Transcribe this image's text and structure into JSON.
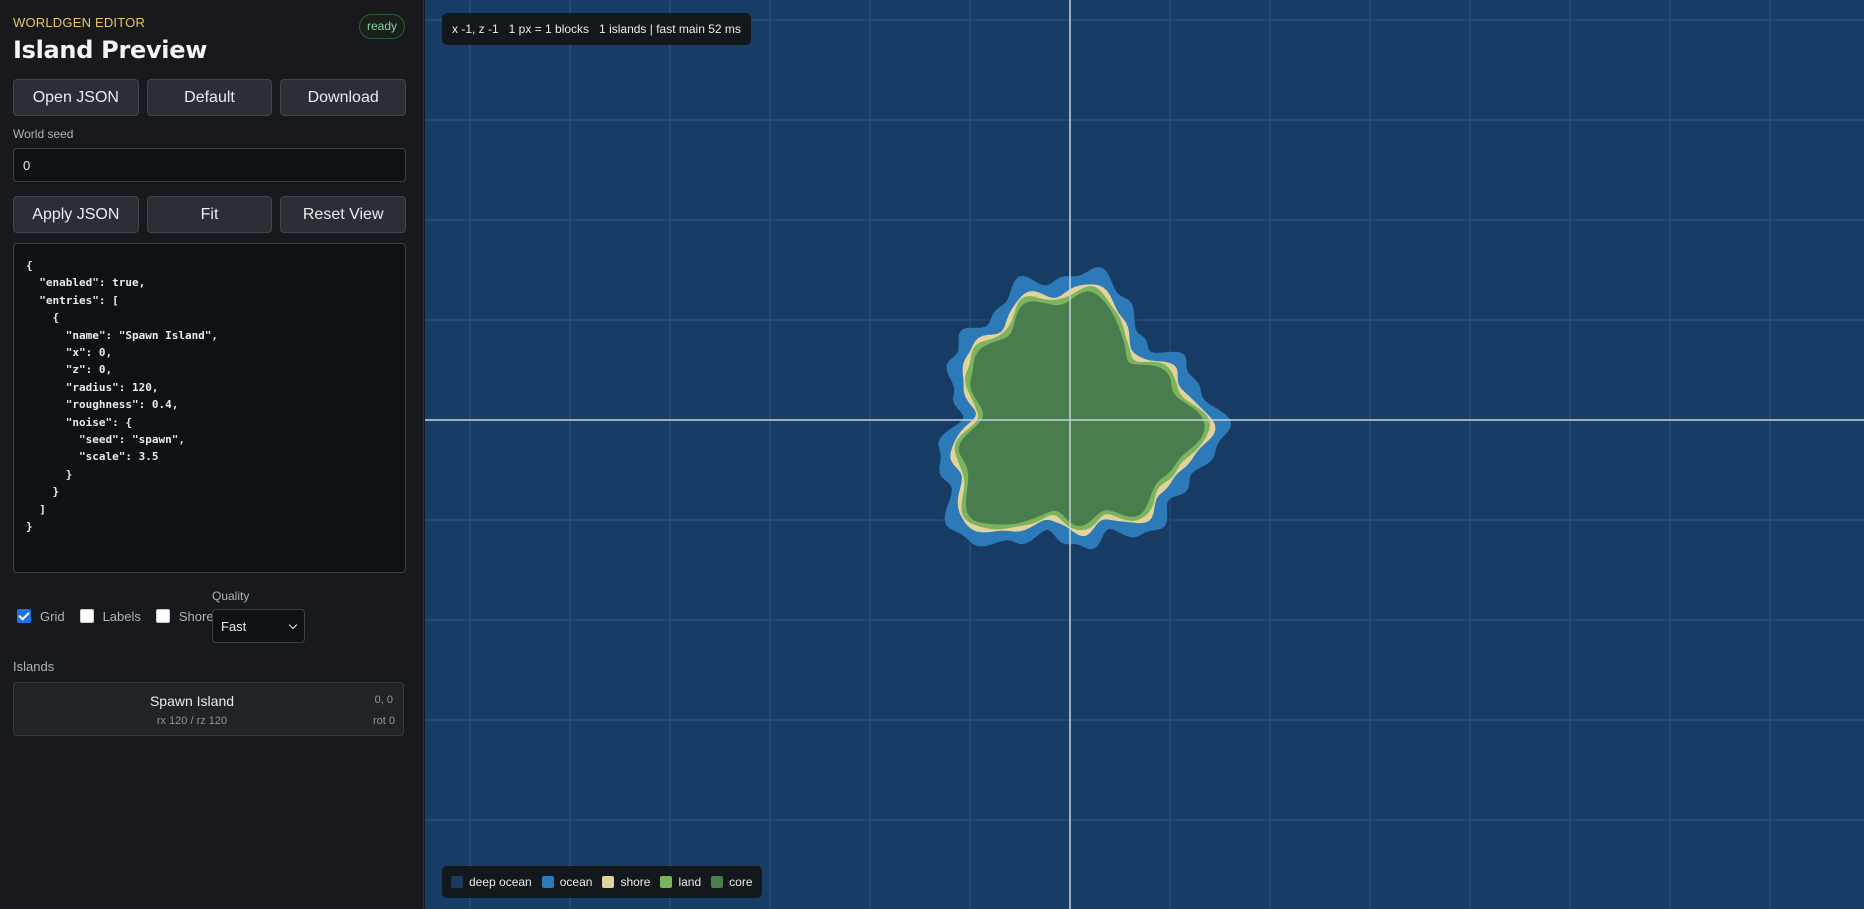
{
  "app": {
    "kicker": "WORLDGEN EDITOR",
    "title": "Island Preview",
    "status": "ready"
  },
  "toolbar": {
    "open_label": "Open JSON",
    "default_label": "Default",
    "download_label": "Download"
  },
  "seed": {
    "label": "World seed",
    "value": "0"
  },
  "actions": {
    "apply_label": "Apply JSON",
    "fit_label": "Fit",
    "reset_label": "Reset View"
  },
  "json_text": "{\n  \"enabled\": true,\n  \"entries\": [\n    {\n      \"name\": \"Spawn Island\",\n      \"x\": 0,\n      \"z\": 0,\n      \"radius\": 120,\n      \"roughness\": 0.4,\n      \"noise\": {\n        \"seed\": \"spawn\",\n        \"scale\": 3.5\n      }\n    }\n  ]\n}",
  "options": {
    "grid": {
      "label": "Grid",
      "checked": true
    },
    "labels": {
      "label": "Labels",
      "checked": false
    },
    "shores": {
      "label": "Shores",
      "checked": false
    },
    "quality": {
      "label": "Quality",
      "value": "Fast"
    }
  },
  "islands": {
    "label": "Islands",
    "items": [
      {
        "name": "Spawn Island",
        "radii": "rx 120 / rz 120",
        "pos": "0, 0",
        "rot": "rot 0"
      }
    ]
  },
  "hud": {
    "text": "x -1, z -1   1 px = 1 blocks   1 islands | fast main 52 ms"
  },
  "legend": [
    {
      "label": "deep ocean",
      "color": "#1b3a5e"
    },
    {
      "label": "ocean",
      "color": "#2d7ab8"
    },
    {
      "label": "shore",
      "color": "#e2d29b"
    },
    {
      "label": "land",
      "color": "#7cb35e"
    },
    {
      "label": "core",
      "color": "#4a7d4d"
    }
  ],
  "map_colors": {
    "background": "#173d66",
    "grid_line": "#2c5683",
    "axis": "#c8d2dc"
  }
}
